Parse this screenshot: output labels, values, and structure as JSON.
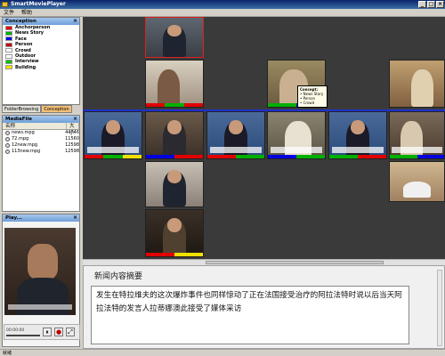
{
  "window": {
    "title": "SmartMoviePlayer"
  },
  "menu": {
    "file": "文件",
    "help": "帮助"
  },
  "concepts_panel": {
    "title": "Conception",
    "items": [
      {
        "label": "Anchorperson",
        "color": "#e00000"
      },
      {
        "label": "News Story",
        "color": "#00b000"
      },
      {
        "label": "Face",
        "color": "#0000e0"
      },
      {
        "label": "Person",
        "color": "#c00000"
      },
      {
        "label": "Crowd",
        "color": "#ffffff"
      },
      {
        "label": "Outdoor",
        "color": "#ffffff"
      },
      {
        "label": "Interview",
        "color": "#00c000"
      },
      {
        "label": "Building",
        "color": "#f0e000"
      }
    ]
  },
  "tabs": [
    {
      "label": "FolderBrowsing"
    },
    {
      "label": "Conception"
    }
  ],
  "mediafile_panel": {
    "title": "MediaFile",
    "col_name": "名称",
    "col_size": "大小",
    "files": [
      {
        "name": "news.mpg",
        "size": "44746"
      },
      {
        "name": "72.mpg",
        "size": "11560"
      },
      {
        "name": "12new.mpg",
        "size": "12598"
      },
      {
        "name": "113new.mpg",
        "size": "12598"
      }
    ]
  },
  "player_panel": {
    "title": "Play...",
    "timestamp": "00:00:00"
  },
  "concept_popup": {
    "title": "Concept:",
    "items": [
      "• News Story",
      "• Person",
      "• Crowd"
    ]
  },
  "summary": {
    "title": "新闻内容摘要",
    "text": "发生在特拉维夫的这次爆炸事件也同样惊动了正在法国接受治疗的阿拉法特时说以后当天阿拉法特的发言人拉蒂娜澳此接受了媒体采访"
  },
  "status": {
    "text": "就绪"
  }
}
